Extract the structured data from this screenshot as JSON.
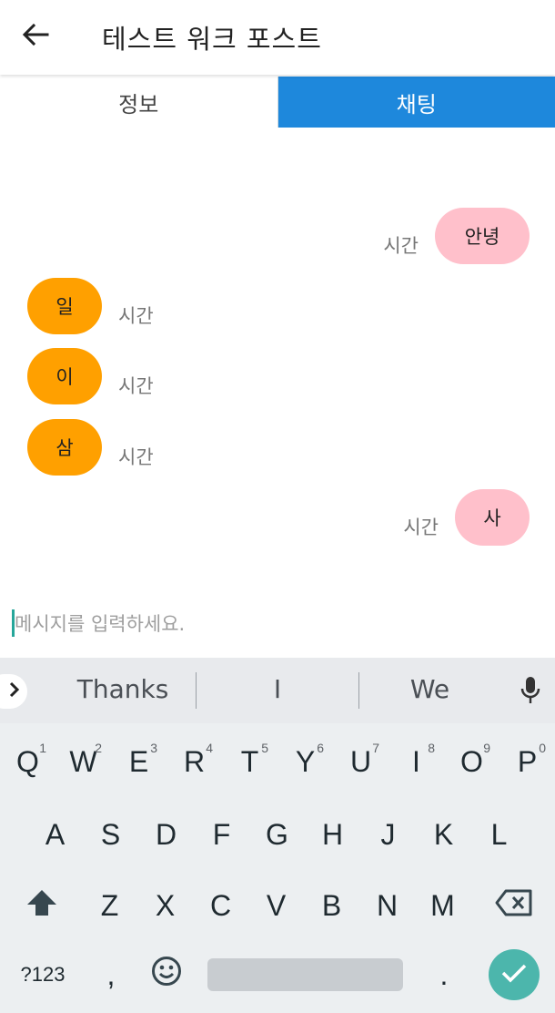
{
  "colors": {
    "accent": "#1e88dc",
    "incoming_bubble": "#ffa000",
    "outgoing_bubble": "#ffc0cb",
    "enter_button": "#4cb6ac"
  },
  "appbar": {
    "back_icon": "arrow-left-icon",
    "title": "테스트 워크 포스트"
  },
  "tabs": [
    {
      "label": "정보",
      "selected": false
    },
    {
      "label": "채팅",
      "selected": true
    }
  ],
  "messages": [
    {
      "side": "right",
      "text": "안녕",
      "time": "시간"
    },
    {
      "side": "left",
      "text": "일",
      "time": "시간"
    },
    {
      "side": "left",
      "text": "이",
      "time": "시간"
    },
    {
      "side": "left",
      "text": "삼",
      "time": "시간"
    },
    {
      "side": "right",
      "text": "사",
      "time": "시간"
    }
  ],
  "input": {
    "placeholder": "메시지를 입력하세요.",
    "value": ""
  },
  "keyboard": {
    "expand_icon": "chevron-right-icon",
    "suggestions": [
      "Thanks",
      "I",
      "We"
    ],
    "mic_icon": "microphone-icon",
    "row1": [
      {
        "key": "Q",
        "hint": "1"
      },
      {
        "key": "W",
        "hint": "2"
      },
      {
        "key": "E",
        "hint": "3"
      },
      {
        "key": "R",
        "hint": "4"
      },
      {
        "key": "T",
        "hint": "5"
      },
      {
        "key": "Y",
        "hint": "6"
      },
      {
        "key": "U",
        "hint": "7"
      },
      {
        "key": "I",
        "hint": "8"
      },
      {
        "key": "O",
        "hint": "9"
      },
      {
        "key": "P",
        "hint": "0"
      }
    ],
    "row2": [
      "A",
      "S",
      "D",
      "F",
      "G",
      "H",
      "J",
      "K",
      "L"
    ],
    "row3": [
      "Z",
      "X",
      "C",
      "V",
      "B",
      "N",
      "M"
    ],
    "shift_icon": "shift-arrow-icon",
    "backspace_icon": "backspace-icon",
    "symbols_label": "?123",
    "comma_label": ",",
    "emoji_icon": "emoji-smile-icon",
    "period_label": ".",
    "enter_icon": "checkmark-icon"
  }
}
